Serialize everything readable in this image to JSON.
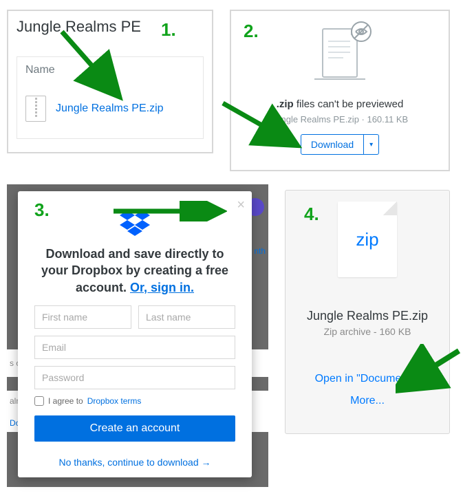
{
  "steps": {
    "one": "1.",
    "two": "2.",
    "three": "3.",
    "four": "4."
  },
  "panel1": {
    "title": "Jungle Realms PE",
    "name_label": "Name",
    "file": "Jungle Realms PE.zip"
  },
  "panel2": {
    "ext": ".zip",
    "nopreview_suffix": " files can't be previewed",
    "meta": "Jungle Realms PE.zip · 160.11 KB",
    "download": "Download",
    "carrot": "▾"
  },
  "panel3": {
    "heading_prefix": "Download and save directly to your Dropbox by creating a free account. ",
    "signin": "Or, sign in.",
    "ph_first": "First name",
    "ph_last": "Last name",
    "ph_email": "Email",
    "ph_password": "Password",
    "terms_prefix": "I agree to ",
    "terms_link": "Dropbox terms",
    "create": "Create an account",
    "nothanks": "No thanks, continue to download →",
    "bg_left1": "s ca",
    "bg_left2": "aln",
    "bg_left3": "Do",
    "bg_right": "nth"
  },
  "panel4": {
    "badge": "zip",
    "name": "Jungle Realms PE.zip",
    "meta": "Zip archive - 160 KB",
    "open": "Open in \"Documents\"",
    "more": "More..."
  }
}
